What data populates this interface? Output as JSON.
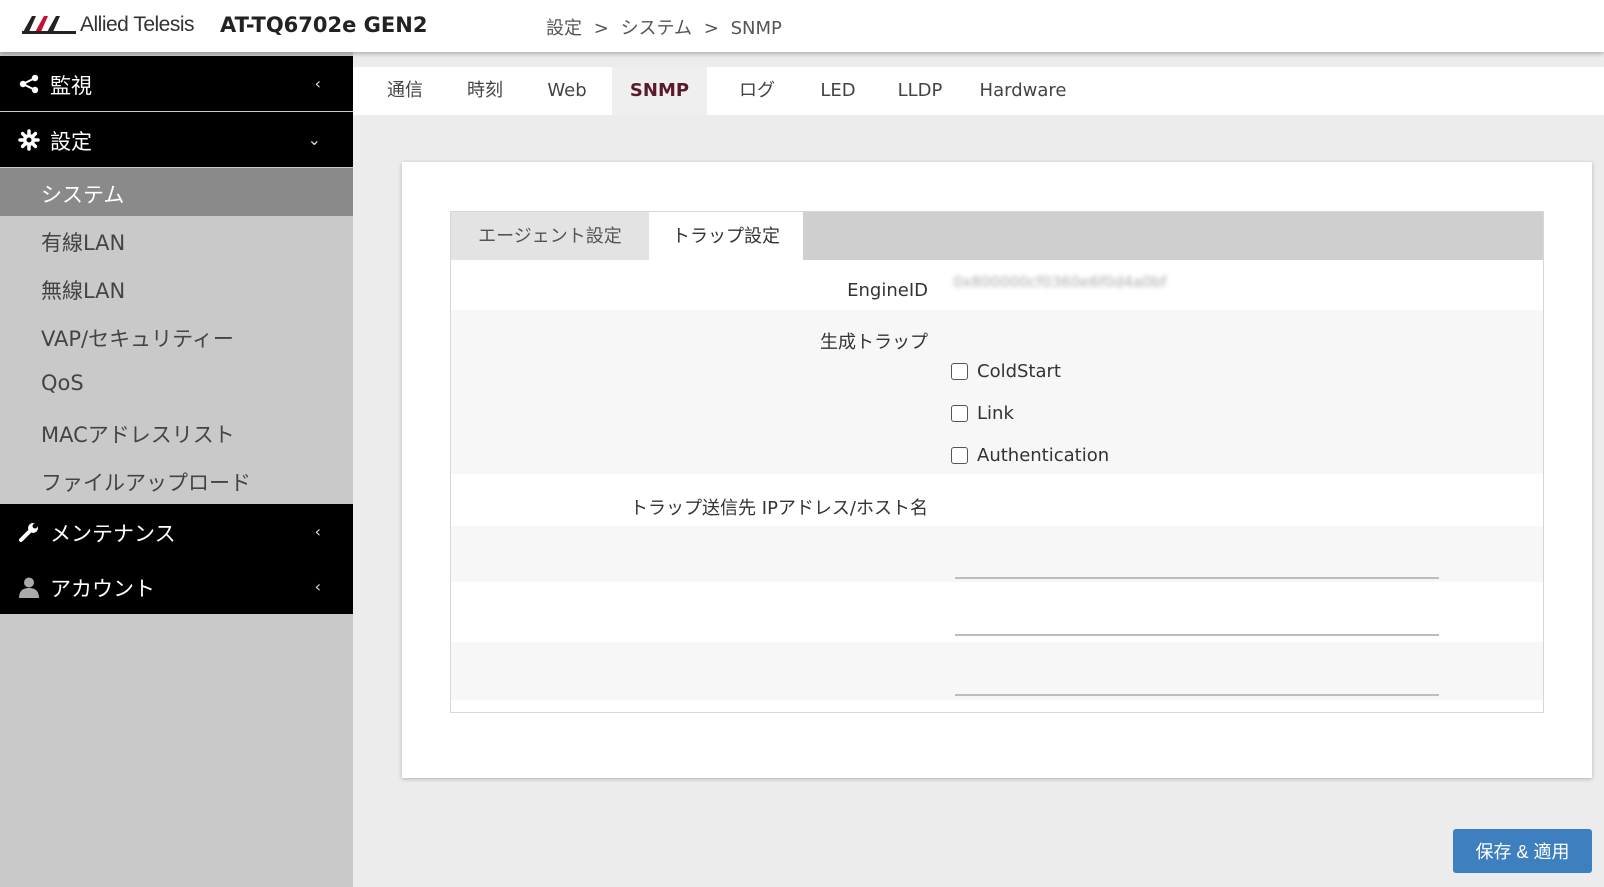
{
  "header": {
    "brand": "Allied Telesis",
    "model": "AT-TQ6702e GEN2",
    "breadcrumb": [
      "設定",
      ">",
      "システム",
      ">",
      "SNMP"
    ]
  },
  "sidebar": {
    "sections": [
      {
        "label": "監視",
        "icon": "share-icon",
        "chevron": "‹"
      },
      {
        "label": "設定",
        "icon": "gear-icon",
        "chevron": "⌄"
      },
      {
        "label": "メンテナンス",
        "icon": "wrench-icon",
        "chevron": "‹"
      },
      {
        "label": "アカウント",
        "icon": "user-icon",
        "chevron": "‹"
      }
    ],
    "settings_items": [
      "システム",
      "有線LAN",
      "無線LAN",
      "VAP/セキュリティー",
      "QoS",
      "MACアドレスリスト",
      "ファイルアップロード"
    ],
    "active_item": "システム"
  },
  "tabs": [
    "通信",
    "時刻",
    "Web",
    "SNMP",
    "ログ",
    "LED",
    "LLDP",
    "Hardware"
  ],
  "active_tab": "SNMP",
  "subtabs": {
    "agent": "エージェント設定",
    "trap": "トラップ設定",
    "active": "トラップ設定"
  },
  "form": {
    "engine_label": "EngineID",
    "engine_value": "0x800000cf0360e6f0d4a0bf",
    "traps_label": "生成トラップ",
    "traps": [
      {
        "label": "ColdStart",
        "checked": false
      },
      {
        "label": "Link",
        "checked": false
      },
      {
        "label": "Authentication",
        "checked": false
      }
    ],
    "dest_label": "トラップ送信先 IPアドレス/ホスト名",
    "dest_values": [
      "",
      "",
      ""
    ]
  },
  "save_button": "保存 & 適用",
  "colors": {
    "accent": "#3d7fbf",
    "active_tab_text": "#5a1a2a",
    "sidebar_dark": "#000000",
    "sidebar_bg": "#c9c9c9"
  }
}
